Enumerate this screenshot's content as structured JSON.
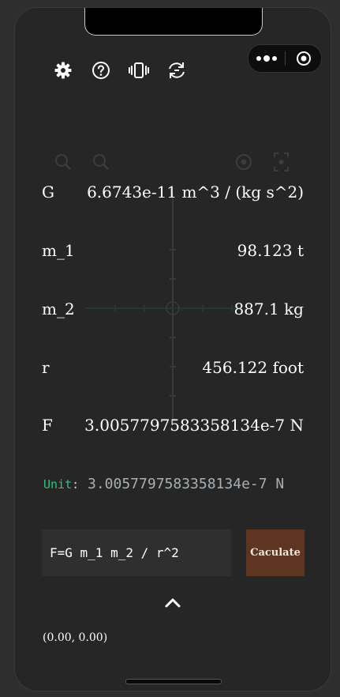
{
  "toolbar": {
    "icons": [
      "gear-icon",
      "help-circle-icon",
      "vibrate-icon",
      "refresh-icon"
    ]
  },
  "capsule": {
    "icons": [
      "more-dots-icon",
      "target-icon"
    ]
  },
  "graph": {
    "icons": [
      "zoom-in-icon",
      "zoom-out-icon",
      "locate-icon",
      "fit-view-icon"
    ],
    "axis_color": "#3a3a3a"
  },
  "fields": [
    {
      "name": "G",
      "value": "6.6743e-11 m^3 / (kg s^2)"
    },
    {
      "name": "m_1",
      "value": "98.123 t"
    },
    {
      "name": "m_2",
      "value": "887.1 kg"
    },
    {
      "name": "r",
      "value": "456.122 foot"
    },
    {
      "name": "F",
      "value": "3.0057797583358134e-7 N"
    }
  ],
  "unit": {
    "label": "Unit",
    "colon": ":",
    "value": "3.0057797583358134e-7 N"
  },
  "formula": {
    "value": "F=G m_1 m_2 / r^2"
  },
  "calculate_label": "Caculate",
  "coords": "(0.00, 0.00)",
  "colors": {
    "background": "#262626",
    "accent_green": "#2ec27e",
    "button_brown": "#5e3520"
  }
}
